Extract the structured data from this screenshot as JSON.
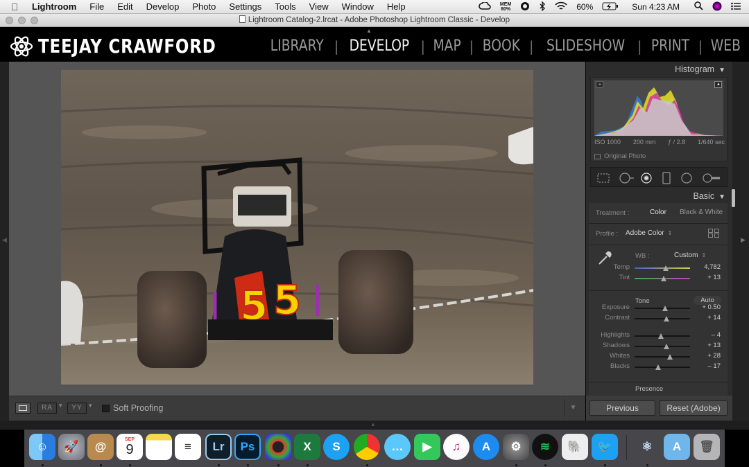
{
  "menubar": {
    "app_name": "Lightroom",
    "items": [
      "File",
      "Edit",
      "Develop",
      "Photo",
      "Settings",
      "Tools",
      "View",
      "Window",
      "Help"
    ],
    "mem_label": "MEM",
    "mem_value": "80%",
    "battery": "60%",
    "clock": "Sun 4:23 AM"
  },
  "window": {
    "title": "Lightroom Catalog-2.lrcat - Adobe Photoshop Lightroom Classic - Develop"
  },
  "identity": {
    "name": "TEEJAY CRAWFORD"
  },
  "modules": [
    "LIBRARY",
    "DEVELOP",
    "MAP",
    "BOOK",
    "SLIDESHOW",
    "PRINT",
    "WEB"
  ],
  "active_module": "DEVELOP",
  "histogram": {
    "header": "Histogram",
    "iso": "ISO 1000",
    "focal": "200 mm",
    "aperture": "ƒ / 2.8",
    "shutter": "1/640 sec",
    "original_photo": "Original Photo"
  },
  "basic": {
    "header": "Basic",
    "treatment_label": "Treatment :",
    "treatment_color": "Color",
    "treatment_bw": "Black & White",
    "profile_label": "Profile :",
    "profile_value": "Adobe Color",
    "wb_label": "WB :",
    "wb_value": "Custom",
    "tone_label": "Tone",
    "auto_label": "Auto",
    "presence_label": "Presence",
    "sliders": [
      {
        "label": "Temp",
        "value": "4,782",
        "pos": 0.56
      },
      {
        "label": "Tint",
        "value": "+ 13",
        "pos": 0.53
      },
      {
        "label": "Exposure",
        "value": "+ 0.50",
        "pos": 0.55
      },
      {
        "label": "Contrast",
        "value": "+ 14",
        "pos": 0.57
      },
      {
        "label": "Highlights",
        "value": "– 4",
        "pos": 0.48
      },
      {
        "label": "Shadows",
        "value": "+ 13",
        "pos": 0.57
      },
      {
        "label": "Whites",
        "value": "+ 28",
        "pos": 0.64
      },
      {
        "label": "Blacks",
        "value": "– 17",
        "pos": 0.42
      }
    ]
  },
  "buttons": {
    "previous": "Previous",
    "reset": "Reset (Adobe)"
  },
  "toolbar": {
    "soft_proofing": "Soft Proofing",
    "ra": "RA",
    "yy": "YY"
  },
  "photo": {
    "car_number": "5"
  },
  "dock": {
    "calendar_month": "SEP",
    "calendar_day": "9",
    "apps": [
      "Finder",
      "Launchpad",
      "Contacts",
      "Calendar",
      "Notes",
      "Reminders",
      "Lightroom",
      "Photoshop",
      "Aperture",
      "Excel",
      "Skype",
      "Chrome",
      "Messages",
      "FaceTime",
      "iTunes",
      "App Store",
      "System Preferences",
      "Spotify",
      "Evernote",
      "Twitter",
      "Atom",
      "Folder",
      "Trash"
    ],
    "lr_label": "Lr",
    "ps_label": "Ps"
  }
}
